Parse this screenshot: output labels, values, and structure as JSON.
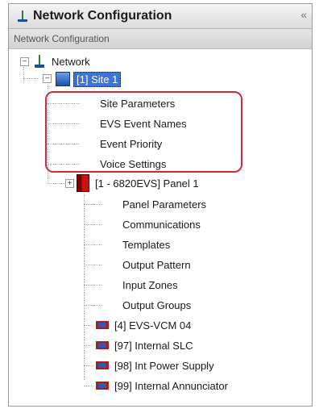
{
  "window": {
    "title": "Network Configuration",
    "collapse_glyph": "«",
    "subtitle": "Network Configuration"
  },
  "tree": {
    "root": {
      "label": "Network",
      "icon": "network-icon",
      "toggle": "−"
    },
    "site": {
      "label": "[1] Site 1",
      "icon": "site-icon",
      "toggle": "−",
      "selected": true
    },
    "site_items": [
      {
        "label": "Site Parameters"
      },
      {
        "label": "EVS Event Names"
      },
      {
        "label": "Event Priority"
      },
      {
        "label": "Voice Settings"
      }
    ],
    "panel": {
      "label": "[1 - 6820EVS] Panel 1",
      "icon": "panel-icon",
      "toggle": "+"
    },
    "panel_items": [
      {
        "label": "Panel Parameters"
      },
      {
        "label": "Communications"
      },
      {
        "label": "Templates"
      },
      {
        "label": "Output Pattern"
      },
      {
        "label": "Input Zones"
      },
      {
        "label": "Output Groups"
      }
    ],
    "devices": [
      {
        "label": "[4] EVS-VCM 04",
        "icon": "device-icon"
      },
      {
        "label": "[97] Internal SLC",
        "icon": "device-icon"
      },
      {
        "label": "[98] Int Power Supply",
        "icon": "device-icon"
      },
      {
        "label": "[99] Internal Annunciator",
        "icon": "device-icon"
      }
    ]
  },
  "colors": {
    "selection": "#3b74d4",
    "highlight_outline": "#d22a36",
    "panel_icon": "#d01010"
  }
}
